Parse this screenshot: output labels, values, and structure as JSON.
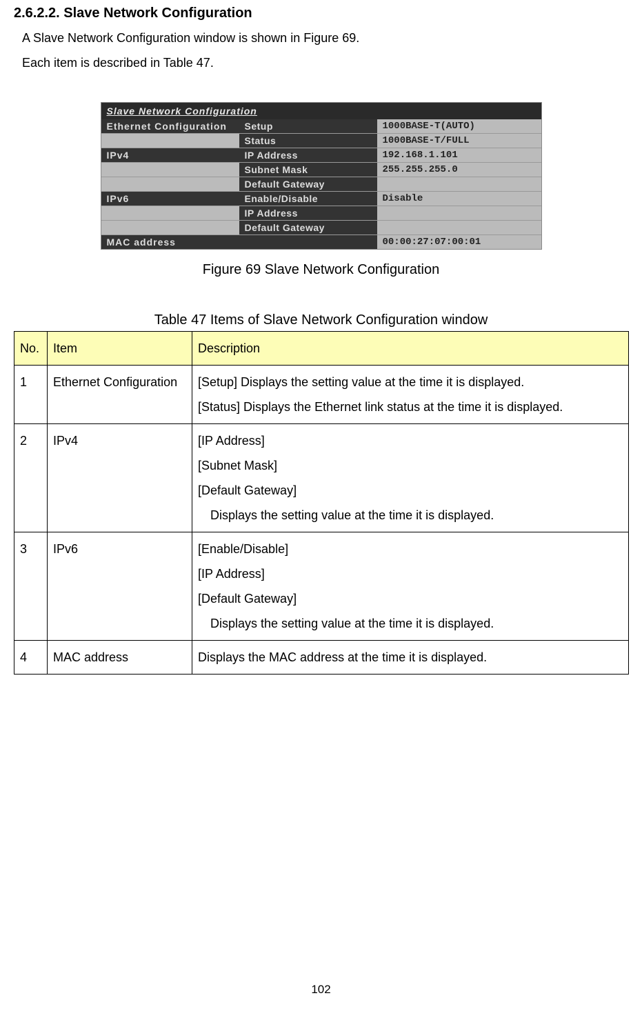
{
  "heading": {
    "section": "2.6.2.2. Slave Network Configuration"
  },
  "intro": {
    "line1": "A Slave Network Configuration window is shown in Figure 69.",
    "line2": "Each item is described in Table 47."
  },
  "figure": {
    "title": "Slave Network Configuration",
    "rows": {
      "eth_label": "Ethernet Configuration",
      "setup_label": "Setup",
      "setup_value": "1000BASE-T(AUTO)",
      "status_label": "Status",
      "status_value": "1000BASE-T/FULL",
      "ipv4_label": "IPv4",
      "ip_label": "IP Address",
      "ip_value": "192.168.1.101",
      "subnet_label": "Subnet Mask",
      "subnet_value": "255.255.255.0",
      "gateway_label": "Default Gateway",
      "gateway_value": "",
      "ipv6_label": "IPv6",
      "enable_label": "Enable/Disable",
      "enable_value": "Disable",
      "ipv6_ip_label": "IP Address",
      "ipv6_ip_value": "",
      "ipv6_gateway_label": "Default Gateway",
      "ipv6_gateway_value": "",
      "mac_label": "MAC address",
      "mac_value": "00:00:27:07:00:01"
    },
    "caption": "Figure 69 Slave Network Configuration"
  },
  "table": {
    "caption": "Table 47 Items of Slave Network Configuration window",
    "headers": {
      "no": "No.",
      "item": "Item",
      "description": "Description"
    },
    "rows": [
      {
        "no": "1",
        "item": "Ethernet Configuration",
        "desc_lines": [
          "[Setup]   Displays the setting value at the time it is displayed.",
          "[Status] Displays the Ethernet link status at the time it is displayed."
        ]
      },
      {
        "no": "2",
        "item": "IPv4",
        "desc_lines": [
          "[IP Address]",
          "[Subnet Mask]",
          "[Default Gateway]"
        ],
        "desc_indent": "Displays the setting value at the time it is displayed."
      },
      {
        "no": "3",
        "item": "IPv6",
        "desc_lines": [
          "[Enable/Disable]",
          "[IP Address]",
          "[Default Gateway]"
        ],
        "desc_indent": "Displays the setting value at the time it is displayed."
      },
      {
        "no": "4",
        "item": "MAC address",
        "desc_lines": [
          "Displays the MAC address at the time it is displayed."
        ]
      }
    ]
  },
  "page_number": "102"
}
